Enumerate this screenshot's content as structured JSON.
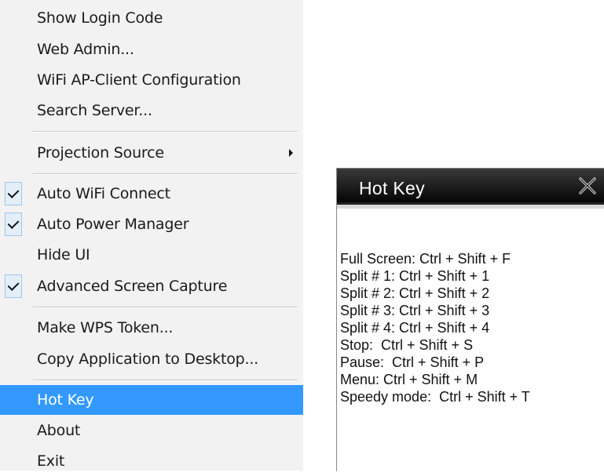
{
  "menu": {
    "items": [
      {
        "label": "Show Login Code",
        "checked": false,
        "submenu": false
      },
      {
        "label": "Web Admin...",
        "checked": false,
        "submenu": false
      },
      {
        "label": "WiFi AP-Client Configuration",
        "checked": false,
        "submenu": false
      },
      {
        "label": "Search Server...",
        "checked": false,
        "submenu": false
      },
      {
        "label": "Projection Source",
        "checked": false,
        "submenu": true
      },
      {
        "label": "Auto WiFi Connect",
        "checked": true,
        "submenu": false
      },
      {
        "label": "Auto Power Manager",
        "checked": true,
        "submenu": false
      },
      {
        "label": "Hide UI",
        "checked": false,
        "submenu": false
      },
      {
        "label": "Advanced Screen Capture",
        "checked": true,
        "submenu": false
      },
      {
        "label": "Make WPS Token...",
        "checked": false,
        "submenu": false
      },
      {
        "label": "Copy Application to Desktop...",
        "checked": false,
        "submenu": false
      },
      {
        "label": "Hot Key",
        "checked": false,
        "submenu": false,
        "highlighted": true
      },
      {
        "label": "About",
        "checked": false,
        "submenu": false
      },
      {
        "label": "Exit",
        "checked": false,
        "submenu": false
      }
    ],
    "highlight_color": "#3399ff"
  },
  "hotkey_window": {
    "title": "Hot Key",
    "close_icon": "close-x-icon",
    "lines": [
      "Full Screen: Ctrl + Shift + F",
      "Split # 1: Ctrl + Shift + 1",
      "Split # 2: Ctrl + Shift + 2",
      "Split # 3: Ctrl + Shift + 3",
      "Split # 4: Ctrl + Shift + 4",
      "Stop:  Ctrl + Shift + S",
      "Pause:  Ctrl + Shift + P",
      "Menu: Ctrl + Shift + M",
      "Speedy mode:  Ctrl + Shift + T"
    ]
  }
}
